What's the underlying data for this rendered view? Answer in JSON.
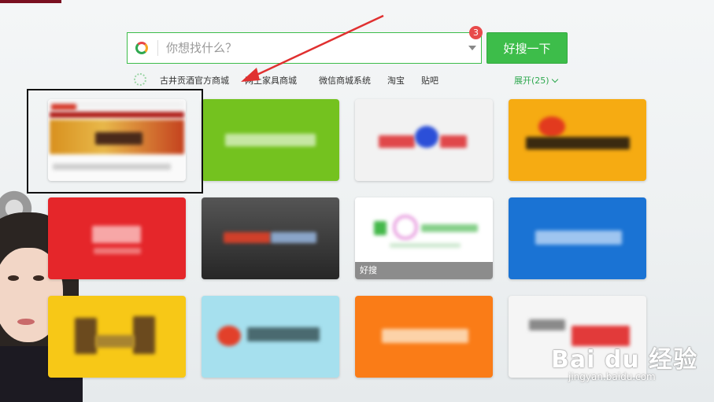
{
  "search": {
    "placeholder": "你想找什么？",
    "badge_count": "3",
    "button_label": "好搜一下"
  },
  "hot_links": [
    "古井贡酒官方商城",
    "网上家具商城",
    "微信商城系统",
    "淘宝",
    "贴吧"
  ],
  "expand_label": "展开(25)",
  "tiles": [
    {
      "caption": ""
    },
    {
      "caption": ""
    },
    {
      "caption": ""
    },
    {
      "caption": ""
    },
    {
      "caption": ""
    },
    {
      "caption": ""
    },
    {
      "caption": "好搜"
    },
    {
      "caption": ""
    },
    {
      "caption": ""
    },
    {
      "caption": ""
    },
    {
      "caption": ""
    },
    {
      "caption": ""
    }
  ],
  "watermark": {
    "main": "Bai du 经验",
    "sub": "jingyan.baidu.com"
  },
  "colors": {
    "accent_green": "#3dbd4a",
    "badge_red": "#e84a4a",
    "annotation_red": "#e03030"
  }
}
